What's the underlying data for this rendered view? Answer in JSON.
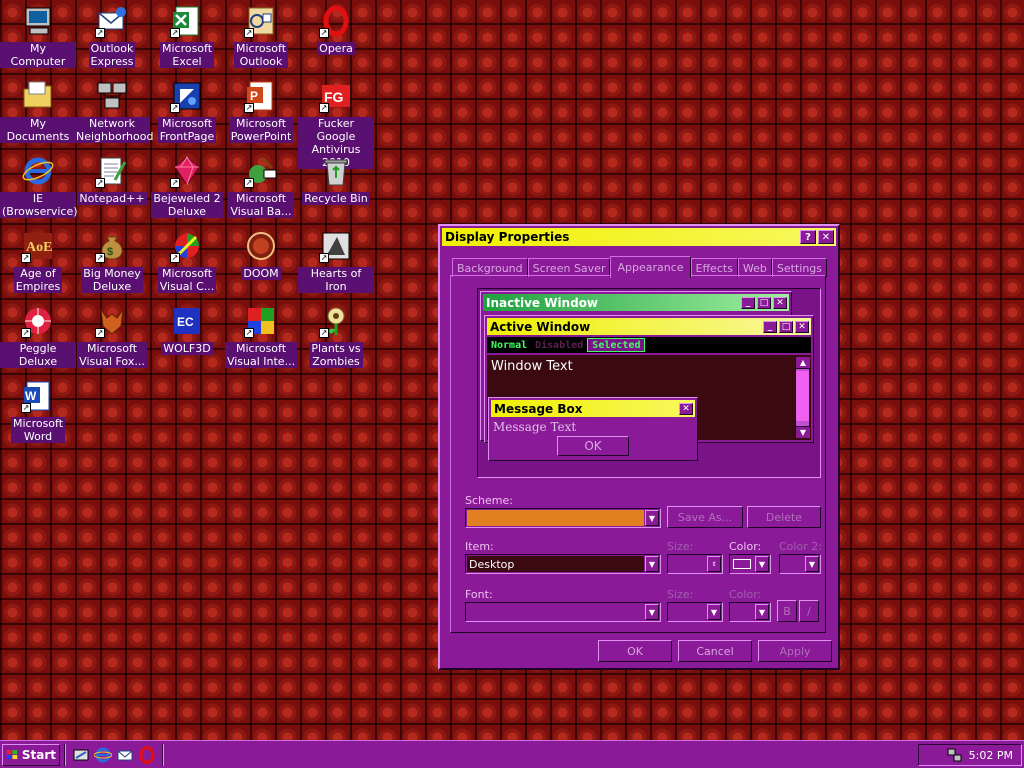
{
  "desktop": {
    "icons": [
      {
        "label": "My Computer",
        "icon": "computer-icon",
        "shortcut": false
      },
      {
        "label": "Outlook\nExpress",
        "icon": "outlook-express-icon",
        "shortcut": true
      },
      {
        "label": "Microsoft\nExcel",
        "icon": "excel-icon",
        "shortcut": true
      },
      {
        "label": "Microsoft\nOutlook",
        "icon": "outlook-icon",
        "shortcut": true
      },
      {
        "label": "Opera",
        "icon": "opera-icon",
        "shortcut": true
      },
      {
        "label": "My Documents",
        "icon": "folder-icon",
        "shortcut": false
      },
      {
        "label": "Network\nNeighborhood",
        "icon": "network-icon",
        "shortcut": false
      },
      {
        "label": "Microsoft\nFrontPage",
        "icon": "frontpage-icon",
        "shortcut": true
      },
      {
        "label": "Microsoft\nPowerPoint",
        "icon": "powerpoint-icon",
        "shortcut": true
      },
      {
        "label": "Fucker Google\nAntivirus 2010",
        "icon": "antivirus-icon",
        "shortcut": true
      },
      {
        "label": "IE\n(Browservice)",
        "icon": "ie-icon",
        "shortcut": false
      },
      {
        "label": "Notepad++",
        "icon": "notepad-icon",
        "shortcut": true
      },
      {
        "label": "Bejeweled 2\nDeluxe",
        "icon": "gem-icon",
        "shortcut": true
      },
      {
        "label": "Microsoft\nVisual Ba...",
        "icon": "visual-basic-icon",
        "shortcut": true
      },
      {
        "label": "Recycle Bin",
        "icon": "recycle-bin-icon",
        "shortcut": false
      },
      {
        "label": "Age of\nEmpires",
        "icon": "age-of-empires-icon",
        "shortcut": true
      },
      {
        "label": "Big Money\nDeluxe",
        "icon": "money-bag-icon",
        "shortcut": true
      },
      {
        "label": "Microsoft\nVisual C...",
        "icon": "visual-c-icon",
        "shortcut": true
      },
      {
        "label": "DOOM",
        "icon": "doom-icon",
        "shortcut": false
      },
      {
        "label": "Hearts of Iron",
        "icon": "hearts-of-iron-icon",
        "shortcut": true
      },
      {
        "label": "Peggle Deluxe",
        "icon": "peggle-icon",
        "shortcut": true
      },
      {
        "label": "Microsoft\nVisual Fox...",
        "icon": "visual-foxpro-icon",
        "shortcut": true
      },
      {
        "label": "WOLF3D",
        "icon": "wolf3d-icon",
        "shortcut": false
      },
      {
        "label": "Microsoft\nVisual Inte...",
        "icon": "visual-interdev-icon",
        "shortcut": true
      },
      {
        "label": "Plants vs\nZombies",
        "icon": "plant-icon",
        "shortcut": true
      },
      {
        "label": "Microsoft\nWord",
        "icon": "word-icon",
        "shortcut": true
      }
    ]
  },
  "dialog": {
    "title": "Display Properties",
    "help_glyph": "?",
    "close_glyph": "✕",
    "tabs": [
      {
        "label": "Background",
        "active": false
      },
      {
        "label": "Screen Saver",
        "active": false
      },
      {
        "label": "Appearance",
        "active": true
      },
      {
        "label": "Effects",
        "active": false
      },
      {
        "label": "Web",
        "active": false
      },
      {
        "label": "Settings",
        "active": false
      }
    ],
    "preview": {
      "inactive_title": "Inactive Window",
      "active_title": "Active Window",
      "menu_normal": "Normal",
      "menu_disabled": "Disabled",
      "menu_selected": "Selected",
      "window_text": "Window Text",
      "msgbox_title": "Message Box",
      "msgbox_text": "Message Text",
      "msgbox_ok": "OK"
    },
    "scheme_label": "Scheme:",
    "scheme_value": "",
    "save_as_label": "Save As...",
    "delete_label": "Delete",
    "item_label": "Item:",
    "item_value": "Desktop",
    "size_label": "Size:",
    "color_label": "Color:",
    "color2_label": "Color 2:",
    "font_label": "Font:",
    "font_value": "",
    "font_size_label": "Size:",
    "font_color_label": "Color:",
    "bold_label": "B",
    "italic_label": "/",
    "ok_label": "OK",
    "cancel_label": "Cancel",
    "apply_label": "Apply"
  },
  "taskbar": {
    "start_label": "Start",
    "clock": "5:02 PM",
    "quick_launch": [
      "show-desktop-icon",
      "ie-icon",
      "outlook-express-icon",
      "opera-icon"
    ]
  },
  "colors": {
    "desktop": "#7a0c0c",
    "dialog_face": "#8a1a98",
    "active_title": "#f0f000",
    "inactive_title_start": "#20a040",
    "scheme_swatch": "#e08020",
    "menu_text": "#40ff60"
  }
}
